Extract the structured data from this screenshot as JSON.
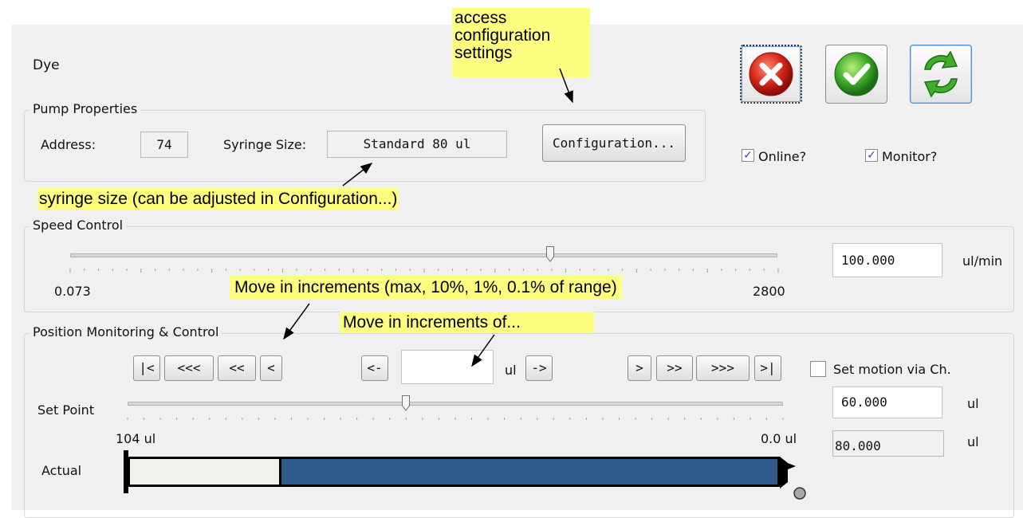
{
  "window": {
    "title": "Dye",
    "buttons": {
      "cancel_icon": "red-x-icon",
      "ok_icon": "green-check-icon",
      "refresh_icon": "refresh-icon"
    },
    "online": {
      "label": "Online?",
      "checked": true
    },
    "monitor": {
      "label": "Monitor?",
      "checked": true
    }
  },
  "pump_properties": {
    "legend": "Pump Properties",
    "address_label": "Address:",
    "address_value": "74",
    "syringe_label": "Syringe Size:",
    "syringe_value": "Standard 80 ul",
    "config_button": "Configuration..."
  },
  "speed_control": {
    "legend": "Speed Control",
    "min_label": "0.073",
    "max_label": "2800",
    "value": "100.000",
    "unit": "ul/min",
    "slider_position": 0.68
  },
  "position": {
    "legend": "Position Monitoring & Control",
    "nav_left": [
      "|<",
      "<<<",
      "<<",
      "<"
    ],
    "nav_right": [
      ">",
      ">>",
      ">>>",
      ">|"
    ],
    "step_left": "<-",
    "step_right": "->",
    "step_value": "",
    "step_unit": "ul",
    "set_motion_label": "Set motion via Ch.",
    "set_motion_checked": false,
    "setpoint_label": "Set Point",
    "setpoint_value": "60.000",
    "setpoint_unit": "ul",
    "setpoint_slider_position": 0.425,
    "left_label": "104 ul",
    "right_label": "0.0 ul",
    "actual_label": "Actual",
    "actual_value": "80.000",
    "actual_unit": "ul",
    "actual_fill_fraction": 0.77,
    "colors": {
      "fill": "#2e5a8c",
      "empty": "#f2f1ec"
    }
  },
  "annotations": {
    "config": "access\nconfiguration\nsettings",
    "syringe": "syringe size (can be adjusted in Configuration...)",
    "increments": "Move in increments (max, 10%, 1%, 0.1% of range)",
    "increments_of": "Move in increments of..."
  }
}
